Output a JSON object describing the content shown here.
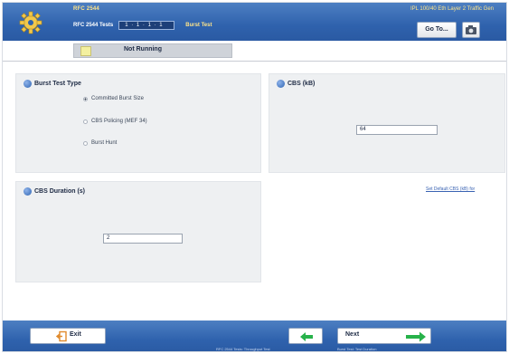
{
  "header": {
    "title": "RFC 2544",
    "subtitle_right": "IPL 100/40 Eth Layer 2 Traffic Gen",
    "test_label": "RFC 2544 Tests",
    "test_select_value": "1 · 1 · 1 · 1",
    "current_test": "Burst Test",
    "goto_label": "Go To...",
    "camera_icon": "camera-icon",
    "gear_icon": "gear-icon"
  },
  "status": {
    "text": "Not Running",
    "led_color": "#f3f0a0"
  },
  "burst_test_type": {
    "title": "Burst Test Type",
    "options": [
      {
        "label": "Committed Burst Size",
        "selected": true
      },
      {
        "label": "CBS Policing (MEF 34)",
        "selected": false
      },
      {
        "label": "Burst Hunt",
        "selected": false
      }
    ]
  },
  "cbs": {
    "title": "CBS (kB)",
    "value": "64"
  },
  "cbs_duration": {
    "title": "CBS Duration (s)",
    "value": "2"
  },
  "link": {
    "text": "Set Default CBS (kB) for"
  },
  "footer": {
    "exit_label": "Exit",
    "next_label": "Next",
    "back_caption": "RFC 2544 Tests: Throughput Test",
    "next_caption": "Burst Test: Test Duration"
  },
  "colors": {
    "header_blue": "#2f62ad",
    "accent_yellow": "#ffe58a",
    "arrow_green": "#27b24a",
    "exit_orange": "#e08a2c"
  }
}
